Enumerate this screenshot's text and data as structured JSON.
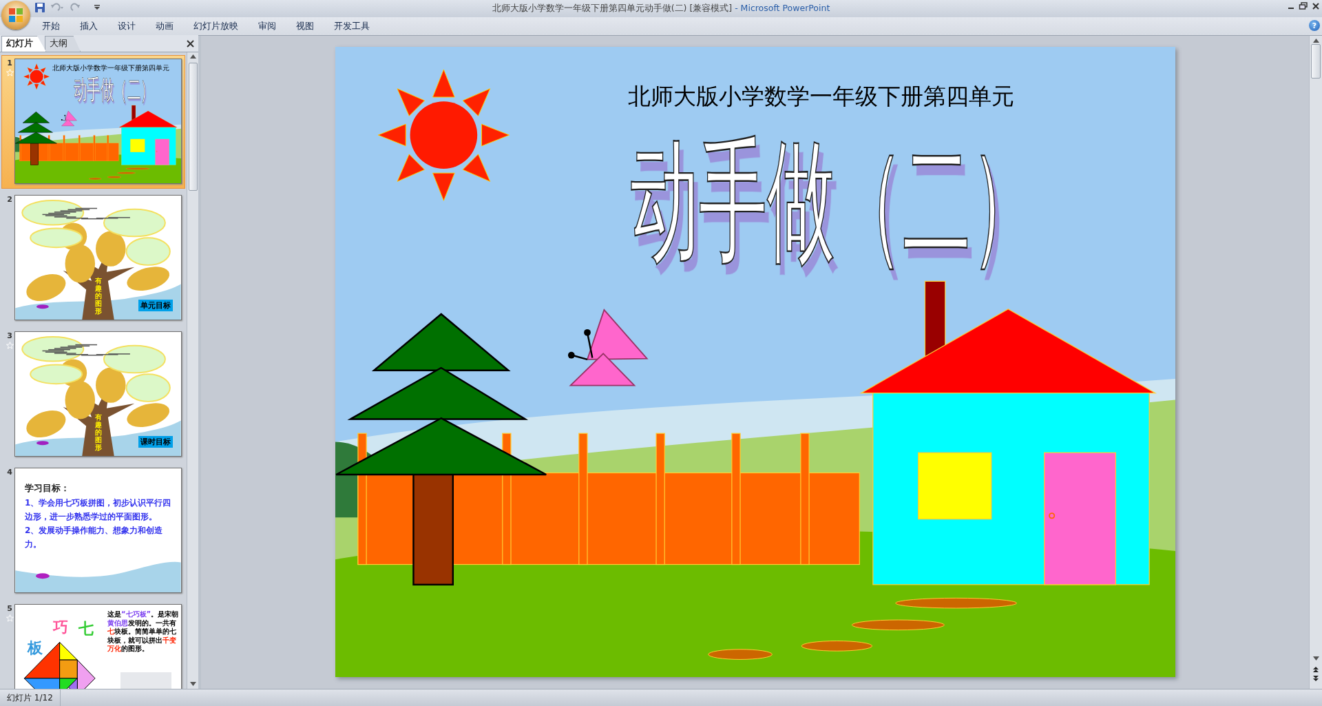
{
  "window": {
    "document_title": "北师大版小学数学一年级下册第四单元动手做(二) [兼容模式]",
    "app_title": "- Microsoft PowerPoint"
  },
  "ribbon_tabs": [
    {
      "label": "开始",
      "selected": false
    },
    {
      "label": "插入",
      "selected": false
    },
    {
      "label": "设计",
      "selected": false
    },
    {
      "label": "动画",
      "selected": false
    },
    {
      "label": "幻灯片放映",
      "selected": false
    },
    {
      "label": "审阅",
      "selected": false
    },
    {
      "label": "视图",
      "selected": false
    },
    {
      "label": "开发工具",
      "selected": false
    }
  ],
  "help": "?",
  "panel_tabs": [
    {
      "label": "幻灯片",
      "selected": true
    },
    {
      "label": "大纲",
      "selected": false
    }
  ],
  "slides": [
    {
      "number": "1",
      "selected": true,
      "animated": true,
      "kind": "title",
      "subtitle": "北师大版小学数学一年级下册第四单元",
      "title": "动手做（二）"
    },
    {
      "number": "2",
      "selected": false,
      "animated": false,
      "kind": "tree",
      "trunk_text": "有趣的图形",
      "tag": "单元目标"
    },
    {
      "number": "3",
      "selected": false,
      "animated": true,
      "kind": "tree",
      "trunk_text": "有趣的图形",
      "tag": "课时目标"
    },
    {
      "number": "4",
      "selected": false,
      "animated": false,
      "kind": "goals",
      "heading": "学习目标：",
      "lines": [
        "1、学会用七巧板拼图，初步认识平行四边形，进一步熟悉学过的平面图形。",
        "2、发展动手操作能力、想象力和创造力。"
      ]
    },
    {
      "number": "5",
      "selected": false,
      "animated": true,
      "kind": "tangram",
      "letters": [
        "巧",
        "七",
        "板"
      ],
      "segments": [
        {
          "text": "这是",
          "kind": "plain"
        },
        {
          "text": "“七巧板”",
          "kind": "name"
        },
        {
          "text": "。是宋朝",
          "kind": "plain"
        },
        {
          "text": "黄伯思",
          "kind": "name"
        },
        {
          "text": "发明的。一共有",
          "kind": "plain"
        },
        {
          "text": "七",
          "kind": "key"
        },
        {
          "text": "块板。简简单单的七块板，就可以拼出",
          "kind": "plain"
        },
        {
          "text": "千变万化",
          "kind": "key"
        },
        {
          "text": "的图形。",
          "kind": "plain"
        }
      ]
    }
  ],
  "slide": {
    "subtitle": "北师大版小学数学一年级下册第四单元",
    "title": "动手做（二）"
  },
  "status_bar": {
    "slide_counter": "幻灯片 1/12"
  }
}
